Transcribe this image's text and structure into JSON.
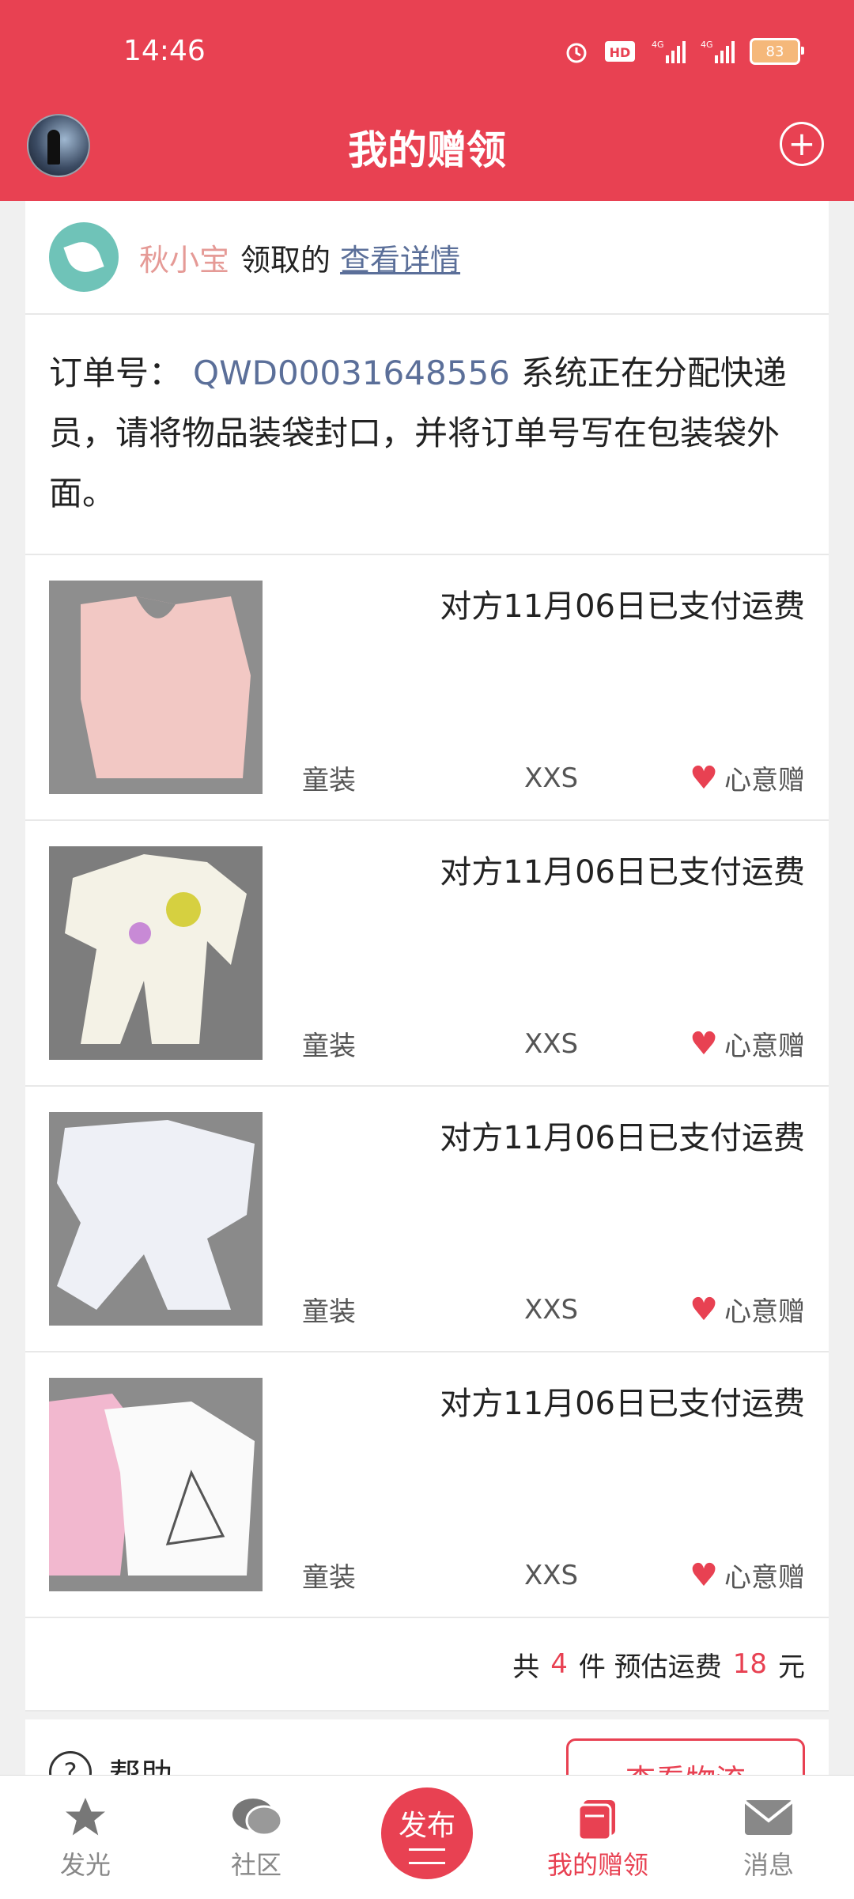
{
  "status_bar": {
    "time": "14:46",
    "battery": "83"
  },
  "header": {
    "title": "我的赠领",
    "icons": {
      "avatar": "user-avatar",
      "add": "plus-circle-icon"
    }
  },
  "claimer": {
    "name": "秋小宝",
    "action": "领取的",
    "link": "查看详情"
  },
  "order": {
    "prefix": "订单号：",
    "number": "QWD00031648556",
    "message": "系统正在分配快递员，请将物品装袋封口，并将订单号写在包装袋外面。"
  },
  "items": [
    {
      "status": "对方11月06日已支付运费",
      "type": "童装",
      "size": "XXS",
      "tag": "心意赠"
    },
    {
      "status": "对方11月06日已支付运费",
      "type": "童装",
      "size": "XXS",
      "tag": "心意赠"
    },
    {
      "status": "对方11月06日已支付运费",
      "type": "童装",
      "size": "XXS",
      "tag": "心意赠"
    },
    {
      "status": "对方11月06日已支付运费",
      "type": "童装",
      "size": "XXS",
      "tag": "心意赠"
    }
  ],
  "summary": {
    "p1": "共",
    "count": "4",
    "p2": "件 预估运费",
    "fee": "18",
    "p3": "元"
  },
  "footer": {
    "help": "帮助",
    "logistics": "查看物流"
  },
  "tabbar": {
    "tabs": [
      {
        "label": "发光",
        "icon": "star-icon"
      },
      {
        "label": "社区",
        "icon": "chat-bubble-icon"
      },
      {
        "label": "发布",
        "icon": "publish-icon"
      },
      {
        "label": "我的赠领",
        "icon": "gift-book-icon"
      },
      {
        "label": "消息",
        "icon": "mail-icon"
      }
    ]
  },
  "colors": {
    "brand": "#e84152",
    "link": "#5b6f99",
    "name": "#e59a96"
  }
}
